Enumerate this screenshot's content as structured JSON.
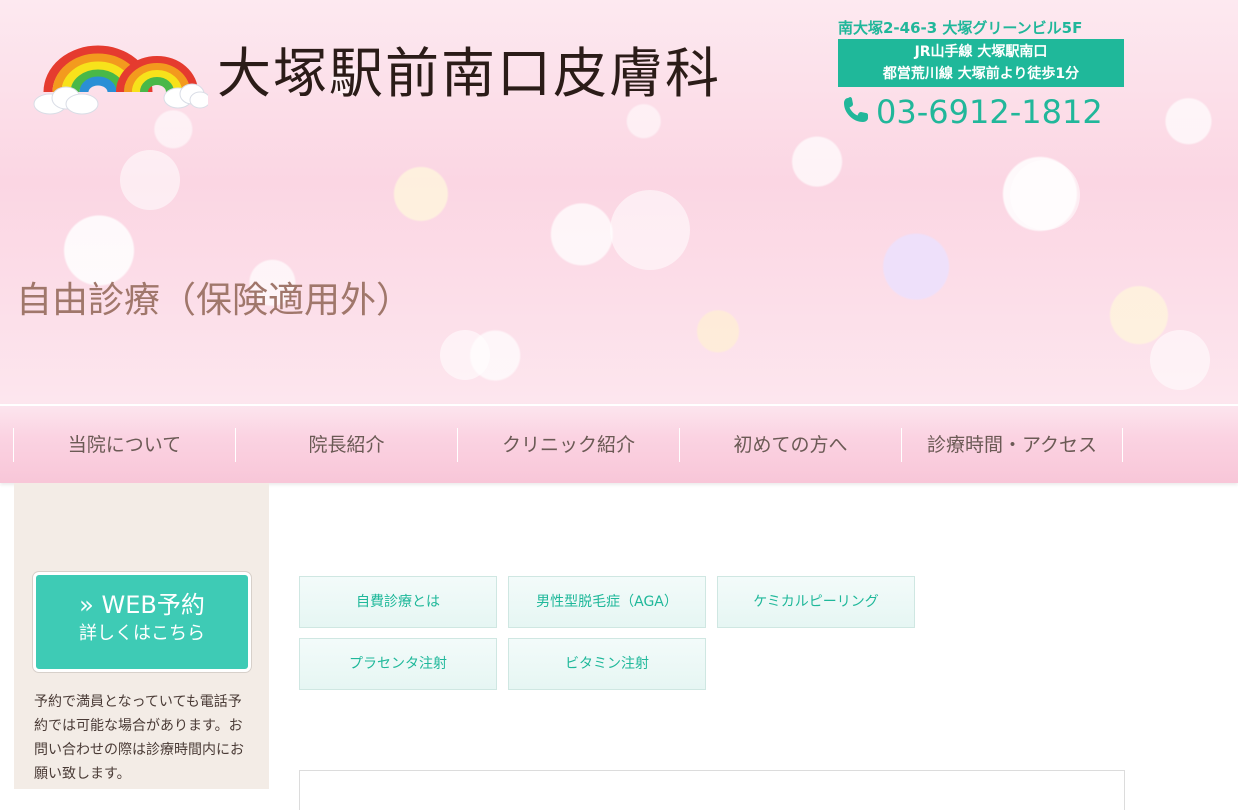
{
  "header": {
    "clinic_name": "大塚駅前南口皮膚科",
    "address": "南大塚2-46-3 大塚グリーンビル5F",
    "access_line1": "JR山手線 大塚駅南口",
    "access_line2": "都営荒川線 大塚前より徒歩1分",
    "phone_number": "03-6912-1812",
    "logo_icon": "rainbow-logo-icon",
    "phone_icon": "phone-icon"
  },
  "page": {
    "title": "自由診療（保険適用外）"
  },
  "nav": {
    "items": [
      {
        "label": "当院について"
      },
      {
        "label": "院長紹介"
      },
      {
        "label": "クリニック紹介"
      },
      {
        "label": "初めての方へ"
      },
      {
        "label": "診療時間・アクセス"
      }
    ]
  },
  "sidebar": {
    "web_reservation_title": "» WEB予約",
    "web_reservation_sub": "詳しくはこちら",
    "note": "予約で満員となっていても電話予約では可能な場合があります。お問い合わせの際は診療時間内にお願い致します。"
  },
  "submenu": {
    "items": [
      {
        "label": "自費診療とは"
      },
      {
        "label": "男性型脱毛症（AGA）"
      },
      {
        "label": "ケミカルピーリング"
      },
      {
        "label": "プラセンタ注射"
      },
      {
        "label": "ビタミン注射"
      }
    ]
  },
  "colors": {
    "accent_green": "#1fb89a",
    "web_button": "#3ecbb5",
    "title_brown": "#a0776b",
    "nav_pink": "#fbd3e2"
  }
}
